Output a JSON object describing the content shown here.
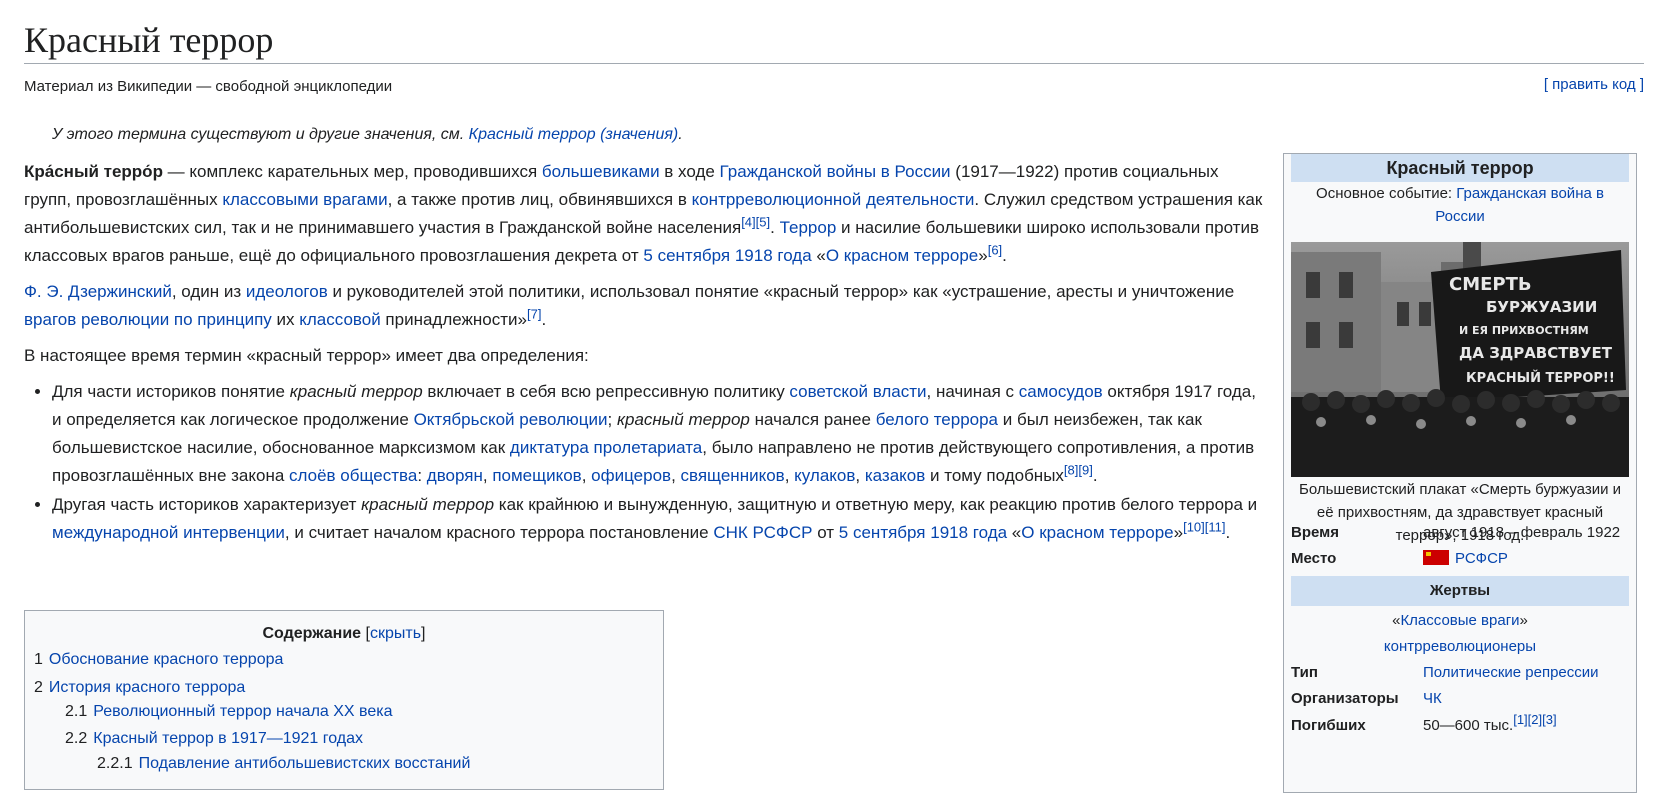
{
  "page": {
    "title": "Красный террор",
    "tagline": "Материал из Википедии — свободной энциклопедии",
    "edit_link": "[ править код ]",
    "hatnote_prefix": "У этого термина существуют и другие значения, см. ",
    "hatnote_link": "Красный террор (значения)",
    "hatnote_suffix": "."
  },
  "para1": {
    "b1": "Кра́сный терро́р",
    "t1": " — комплекс карательных мер, проводившихся ",
    "l1": "большевиками",
    "t2": " в ходе ",
    "l2": "Гражданской войны в России",
    "t3": " (1917—1922) против социальных групп, провозглашённых ",
    "l3": "классовыми врагами",
    "t4": ", а также против лиц, обвинявшихся в ",
    "l4": "контрреволюционной деятельности",
    "t5": ". Служил средством устрашения как антибольшевистских сил, так и не принимавшего участия в Гражданской войне населения",
    "r1": "[4]",
    "r2": "[5]",
    "t6": ". ",
    "l5": "Террор",
    "t7": " и насилие большевики широко использовали против классовых врагов раньше, ещё до официального провозглашения декрета от ",
    "l6": "5 сентября 1918 года",
    "t8": " «",
    "l7": "О красном терроре",
    "t9": "»",
    "r3": "[6]",
    "t10": "."
  },
  "para2": {
    "l1": "Ф. Э. Дзержинский",
    "t1": ", один из ",
    "l2": "идеологов",
    "t2": " и руководителей этой политики, использовал понятие «красный террор» как «устрашение, аресты и уничтожение ",
    "l3": "врагов революции по принципу",
    "t3": " их ",
    "l4": "классовой",
    "t4": " принадлежности»",
    "r1": "[7]",
    "t5": "."
  },
  "para3": "В настоящее время термин «красный террор» имеет два определения:",
  "bullet1": {
    "t1": "Для части историков понятие ",
    "i1": "красный террор",
    "t2": " включает в себя всю репрессивную политику ",
    "l1": "советской власти",
    "t3": ", начиная с ",
    "l2": "самосудов",
    "t4": " октября 1917 года, и определяется как логическое продолжение ",
    "l3": "Октябрьской революции",
    "t5": "; ",
    "i2": "красный террор",
    "t6": " начался ранее ",
    "l4": "белого террора",
    "t7": " и был неизбежен, так как большевистское насилие, обоснованное марксизмом как ",
    "l5": "диктатура пролетариата",
    "t8": ", было направлено не против действующего сопротивления, а против провозглашённых вне закона ",
    "l6": "слоёв общества",
    "t9": ": ",
    "l7": "дворян",
    "t10": ", ",
    "l8": "помещиков",
    "t11": ", ",
    "l9": "офицеров",
    "t12": ", ",
    "l10": "священников",
    "t13": ", ",
    "l11": "кулаков",
    "t14": ", ",
    "l12": "казаков",
    "t15": " и тому подобных",
    "r1": "[8]",
    "r2": "[9]",
    "t16": "."
  },
  "bullet2": {
    "t1": "Другая часть историков характеризует ",
    "i1": "красный террор",
    "t2": " как крайнюю и вынужденную, защитную и ответную меру, как реакцию против белого террора и ",
    "l1": "международной интервенции",
    "t3": ", и считает началом красного террора постановление ",
    "l2": "СНК РСФСР",
    "t4": " от ",
    "l3": "5 сентября 1918 года",
    "t5": " «",
    "l4": "О красном терроре",
    "t6": "»",
    "r1": "[10]",
    "r2": "[11]",
    "t7": "."
  },
  "toc": {
    "title": "Содержание",
    "toggle_open": "[",
    "toggle": "скрыть",
    "toggle_close": "]",
    "items": [
      {
        "num": "1",
        "label": "Обоснование красного террора"
      },
      {
        "num": "2",
        "label": "История красного террора"
      },
      {
        "num": "2.1",
        "label": "Революционный террор начала XX века"
      },
      {
        "num": "2.2",
        "label": "Красный террор в 1917—1921 годах"
      },
      {
        "num": "2.2.1",
        "label": "Подавление антибольшевистских восстаний"
      }
    ]
  },
  "infobox": {
    "title": "Красный террор",
    "main_event_label": "Основное событие: ",
    "main_event_link": "Гражданская война в России",
    "poster_line1": "СМЕРТЬ",
    "poster_line2": "БУРЖУАЗИИ",
    "poster_line3": "И ЕЯ ПРИХВОСТНЯМ",
    "poster_line4": "ДА ЗДРАВСТВУЕТ",
    "poster_line5": "КРАСНЫЙ ТЕРРОР!!",
    "caption": "Большевистский плакат «Смерть буржуазии и её прихвостням, да здравствует красный террор», 1918 год.",
    "time_label": "Время",
    "time_value": "август 1918 – февраль 1922",
    "place_label": "Место",
    "place_value": "РСФСР",
    "victims_header": "Жертвы",
    "victims_q1": "«",
    "victims_link1": "Классовые враги",
    "victims_q2": "»",
    "victims_link2": "контрреволюционеры",
    "type_label": "Тип",
    "type_value": "Политические репрессии",
    "org_label": "Организаторы",
    "org_value": "ЧК",
    "dead_label": "Погибших",
    "dead_value": "50—600 тыс.",
    "dead_r1": "[1]",
    "dead_r2": "[2]",
    "dead_r3": "[3]"
  },
  "colors": {
    "link": "#0645ad",
    "header_bg": "#cedff2",
    "box_bg": "#f8f9fa",
    "border": "#a2a9b1"
  }
}
